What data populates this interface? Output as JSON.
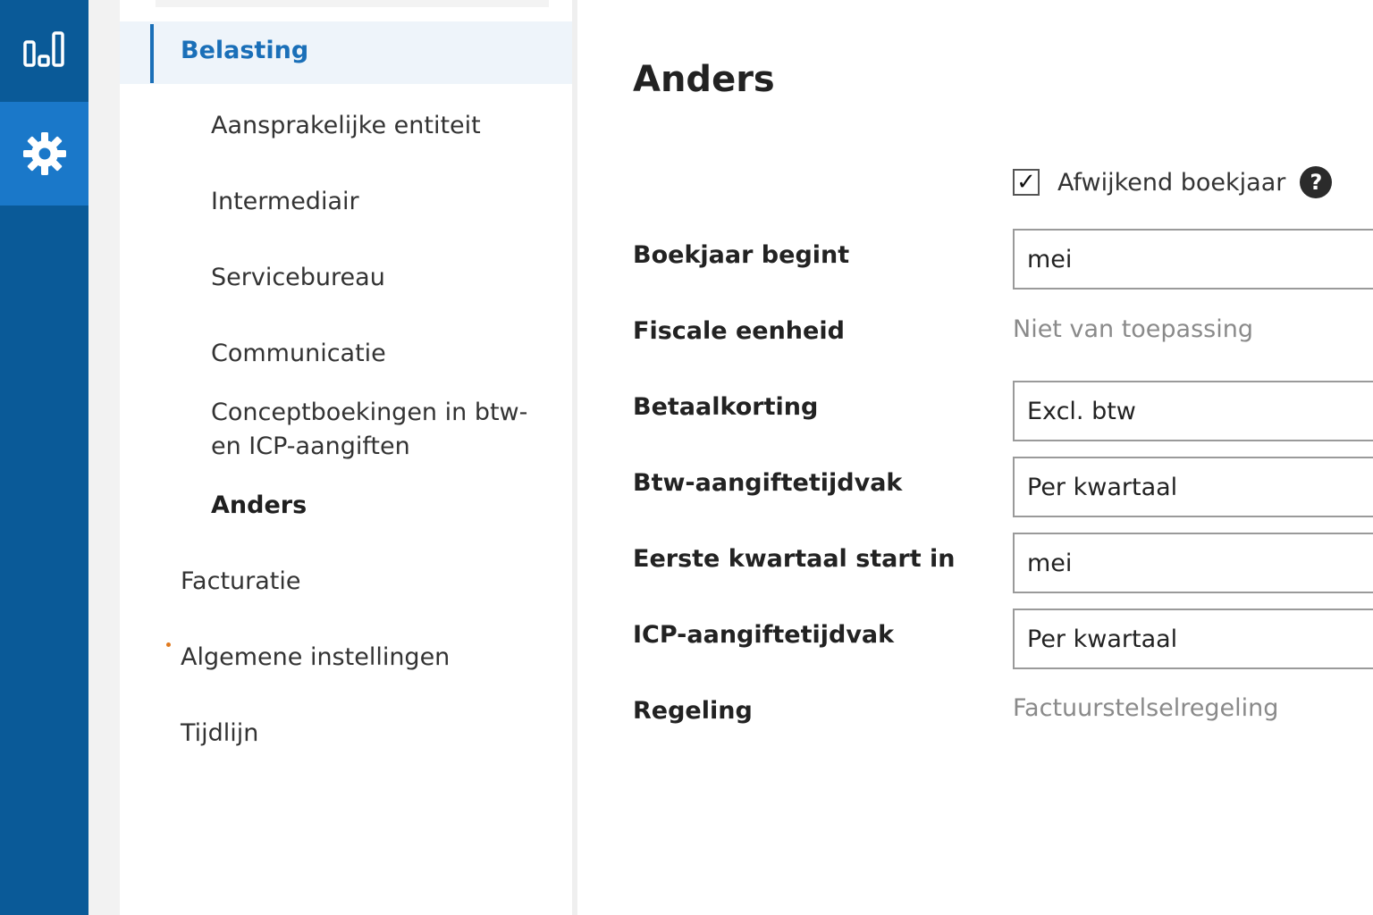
{
  "rail": {
    "items": [
      {
        "name": "reports",
        "icon": "bar-chart-icon"
      },
      {
        "name": "settings",
        "icon": "gear-icon",
        "active": true
      }
    ],
    "colors": {
      "background": "#0a5a98",
      "active": "#1a78c9"
    }
  },
  "nav": {
    "items": [
      {
        "label": "Belasting",
        "active": true
      },
      {
        "label": "Aansprakelijke entiteit"
      },
      {
        "label": "Intermediair"
      },
      {
        "label": "Servicebureau"
      },
      {
        "label": "Communicatie"
      },
      {
        "label_line1": "Conceptboekingen in btw-",
        "label_line2": "en ICP-aangiften"
      },
      {
        "label": "Anders",
        "current": true
      },
      {
        "label": "Facturatie"
      },
      {
        "label": "Algemene instellingen",
        "required_marker": "*"
      },
      {
        "label": "Tijdlijn"
      }
    ],
    "accent_color": "#1a6fb8"
  },
  "main": {
    "title": "Anders",
    "afwijkend_boekjaar": {
      "label": "Afwijkend boekjaar",
      "checked": true,
      "check_glyph": "✓",
      "help_glyph": "?"
    },
    "fields": {
      "boekjaar_begint": {
        "label": "Boekjaar begint",
        "value": "mei"
      },
      "fiscale_eenheid": {
        "label": "Fiscale eenheid",
        "value": "Niet van toepassing"
      },
      "betaalkorting": {
        "label": "Betaalkorting",
        "value": "Excl. btw"
      },
      "btw_aangiftetijdvak": {
        "label": "Btw-aangiftetijdvak",
        "value": "Per kwartaal"
      },
      "eerste_kwartaal": {
        "label": "Eerste kwartaal start in",
        "value": "mei"
      },
      "icp_aangiftetijdvak": {
        "label": "ICP-aangiftetijdvak",
        "value": "Per kwartaal"
      },
      "regeling": {
        "label": "Regeling",
        "value": "Factuurstelselregeling"
      }
    }
  }
}
